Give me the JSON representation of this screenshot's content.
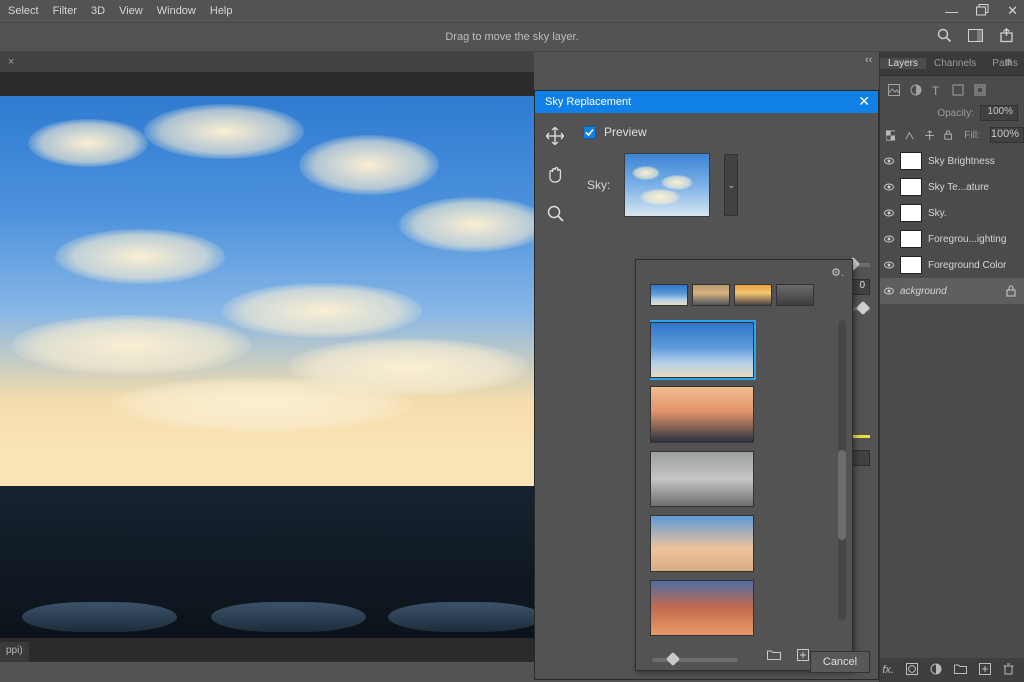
{
  "menubar": {
    "items": [
      "Select",
      "Filter",
      "3D",
      "View",
      "Window",
      "Help"
    ]
  },
  "optbar": {
    "hint": "Drag to move the sky layer."
  },
  "doc_footer": "ppi)",
  "right_panel": {
    "tabs": [
      "Layers",
      "Channels",
      "Paths"
    ],
    "opacity_label": "Opacity:",
    "opacity_value": "100%",
    "fill_label": "Fill:",
    "fill_value": "100%",
    "layers": [
      {
        "name": "Sky Brightness",
        "sel": false
      },
      {
        "name": "Sky Te...ature",
        "sel": false
      },
      {
        "name": "Sky.",
        "sel": false
      },
      {
        "name": "Foregrou...ighting",
        "sel": false
      },
      {
        "name": "Foreground Color",
        "sel": false
      },
      {
        "name": "ackground",
        "sel": true
      }
    ]
  },
  "sky_dialog": {
    "title": "Sky Replacement",
    "preview_label": "Preview",
    "sky_label": "Sky:",
    "value_box": "0",
    "cancel": "Cancel"
  }
}
